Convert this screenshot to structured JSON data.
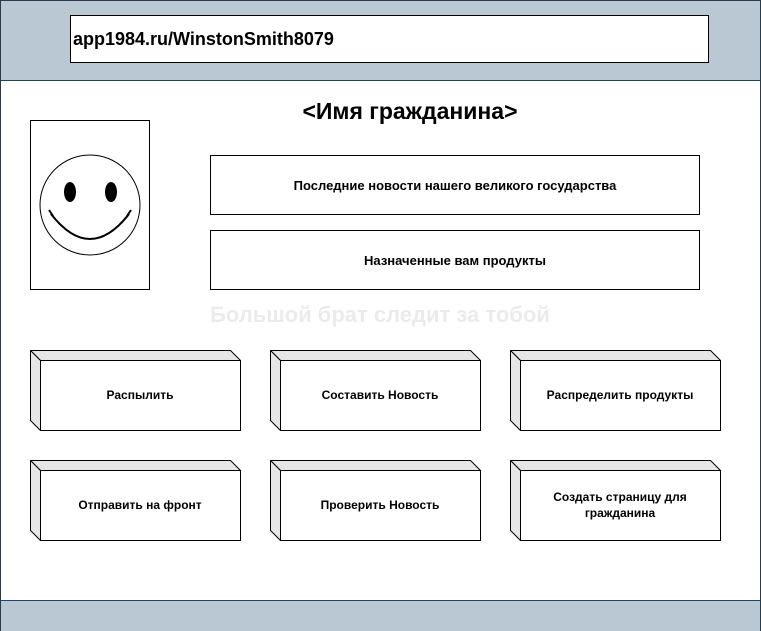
{
  "address_bar": {
    "url": "app1984.ru/WinstonSmith8079"
  },
  "profile": {
    "citizen_name": "<Имя гражданина>",
    "avatar_icon": "smiley-face-icon"
  },
  "info_buttons": {
    "news": "Последние новости нашего великого государства",
    "products": "Назначенные вам продукты"
  },
  "watermark": "Большой брат следит за тобой",
  "actions": {
    "spray": "Распылить",
    "compose_news": "Составить Новость",
    "distribute_products": "Распределить продукты",
    "send_to_front": "Отправить на фронт",
    "check_news": "Проверить Новость",
    "create_citizen_page": "Создать страницу для гражданина"
  },
  "colors": {
    "bar": "#bac8d3",
    "bar_border": "#23445d",
    "block_side": "#e6e6e6",
    "watermark": "#ebebeb"
  }
}
